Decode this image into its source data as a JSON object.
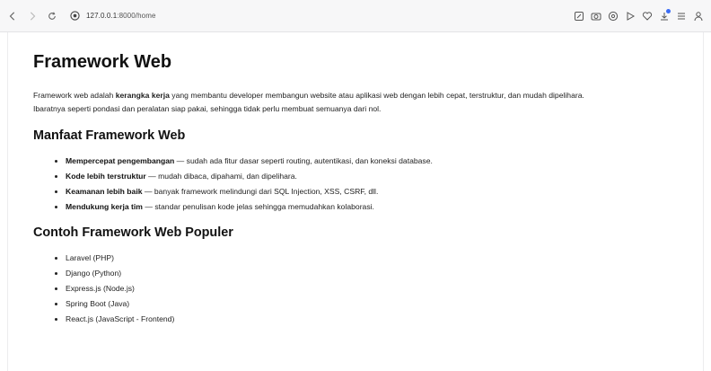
{
  "browser": {
    "url_host": "127.0.0.1",
    "url_rest": ":8000/home",
    "icons": [
      "back-icon",
      "forward-icon",
      "reload-icon",
      "site-info-icon",
      "edit-icon",
      "screenshot-icon",
      "shield-icon",
      "play-icon",
      "heart-icon",
      "downloads-icon",
      "menu-icon",
      "profile-icon"
    ]
  },
  "page": {
    "title": "Framework Web",
    "intro": {
      "part1": "Framework web adalah ",
      "bold": "kerangka kerja",
      "part2": " yang membantu developer membangun website atau aplikasi web dengan lebih cepat, terstruktur, dan mudah dipelihara.",
      "line2": "Ibaratnya seperti pondasi dan peralatan siap pakai, sehingga tidak perlu membuat semuanya dari nol."
    },
    "benefits": {
      "heading": "Manfaat Framework Web",
      "items": [
        {
          "bold": "Mempercepat pengembangan",
          "text": " — sudah ada fitur dasar seperti routing, autentikasi, dan koneksi database."
        },
        {
          "bold": "Kode lebih terstruktur",
          "text": " — mudah dibaca, dipahami, dan dipelihara."
        },
        {
          "bold": "Keamanan lebih baik",
          "text": " — banyak framework melindungi dari SQL Injection, XSS, CSRF, dll."
        },
        {
          "bold": "Mendukung kerja tim",
          "text": " — standar penulisan kode jelas sehingga memudahkan kolaborasi."
        }
      ]
    },
    "examples": {
      "heading": "Contoh Framework Web Populer",
      "items": [
        "Laravel (PHP)",
        "Django (Python)",
        "Express.js (Node.js)",
        "Spring Boot (Java)",
        "React.js (JavaScript - Frontend)"
      ]
    }
  }
}
